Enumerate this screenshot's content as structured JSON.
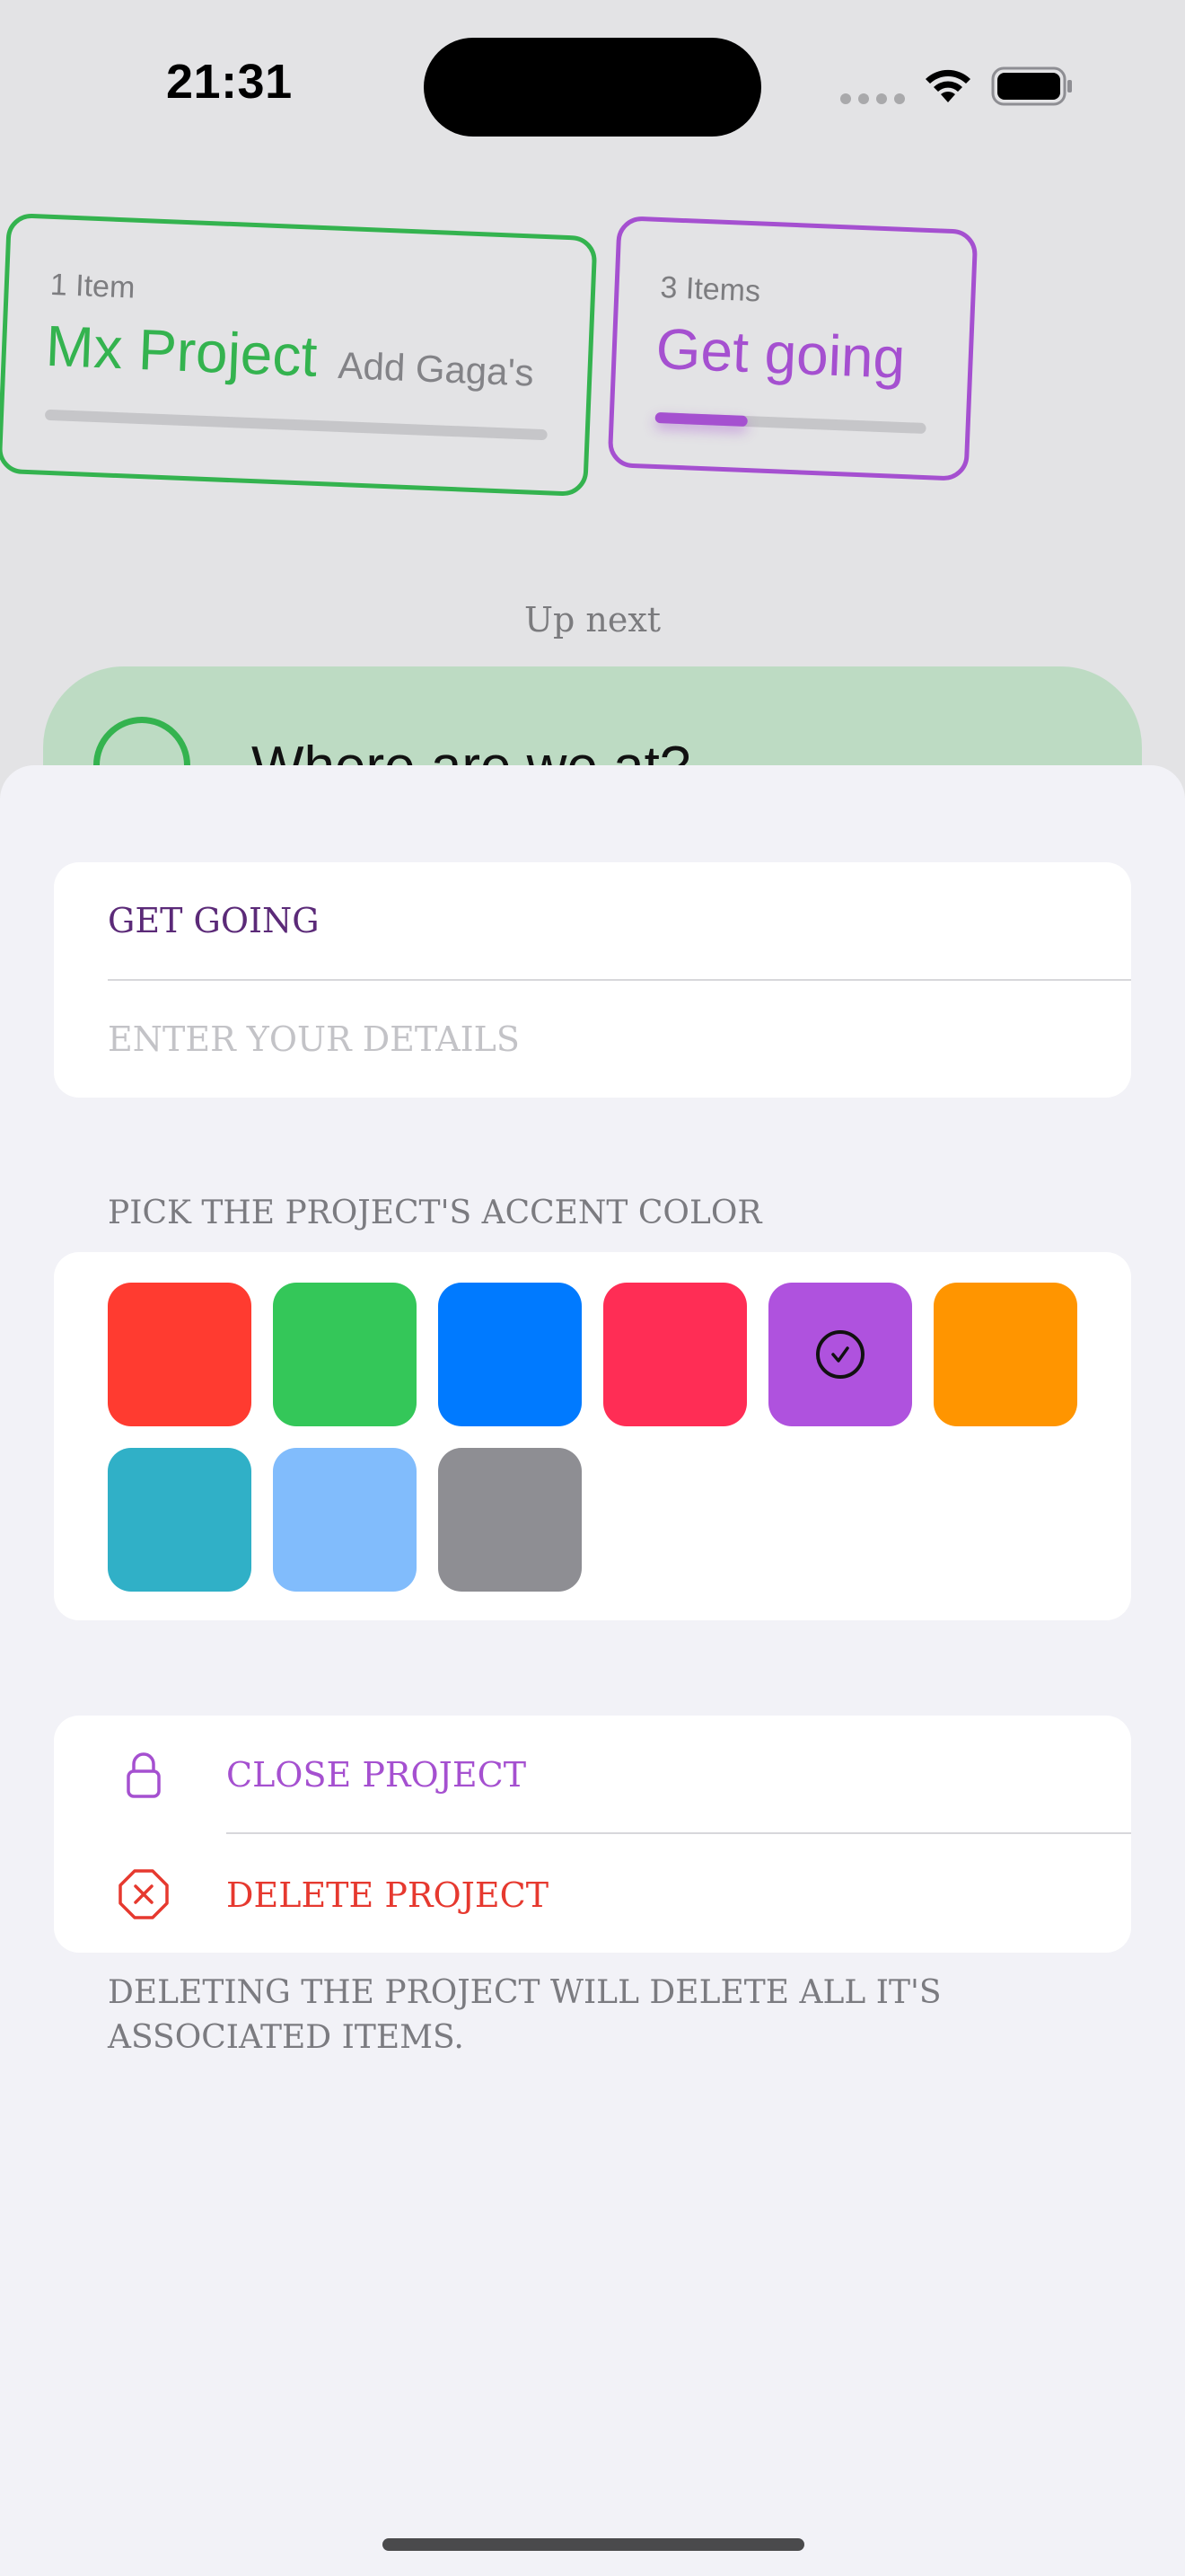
{
  "status_bar": {
    "time": "21:31"
  },
  "projects": [
    {
      "count": "1 Item",
      "name": "Mx Project",
      "subtitle": "Add Gaga's",
      "color": "#34b34f",
      "progress": 0.0
    },
    {
      "count": "3 Items",
      "name": "Get going",
      "color": "#a550d0",
      "progress": 0.34
    }
  ],
  "up_next": {
    "heading": "Up next",
    "item_text": "Where are we at?",
    "item_color": "#34b34f"
  },
  "sheet": {
    "title_value": "GET GOING",
    "details_placeholder": "ENTER YOUR DETAILS",
    "accent_header": "PICK THE PROJECT'S ACCENT COLOR",
    "colors": [
      {
        "name": "red",
        "hex": "#ff3b30"
      },
      {
        "name": "green",
        "hex": "#34c759"
      },
      {
        "name": "blue",
        "hex": "#007aff"
      },
      {
        "name": "pink",
        "hex": "#ff2d55"
      },
      {
        "name": "purple",
        "hex": "#af52de",
        "selected": true
      },
      {
        "name": "orange",
        "hex": "#ff9500"
      },
      {
        "name": "teal",
        "hex": "#30b0c7"
      },
      {
        "name": "light-blue",
        "hex": "#81bcfc"
      },
      {
        "name": "gray",
        "hex": "#8e8e93"
      }
    ],
    "close_label": "CLOSE PROJECT",
    "close_icon": "lock-icon",
    "delete_label": "DELETE PROJECT",
    "delete_icon": "xmark-octagon-icon",
    "footer_note": "DELETING THE PROJECT WILL DELETE ALL IT'S ASSOCIATED ITEMS."
  }
}
